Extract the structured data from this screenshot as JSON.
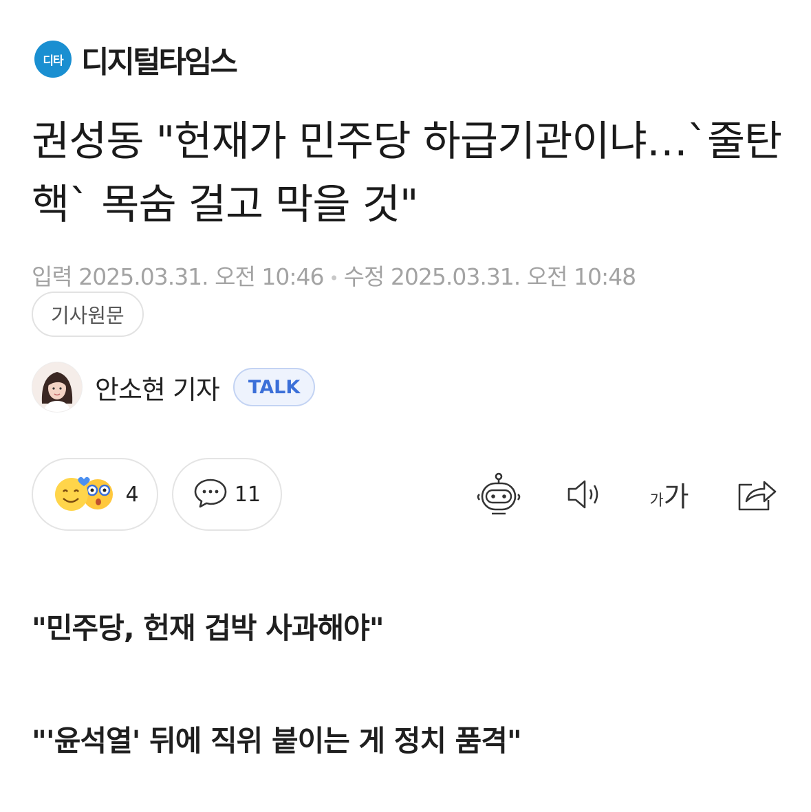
{
  "brand": {
    "badge": "디타",
    "name": "디지털타임스"
  },
  "headline": "권성동 \"헌재가 민주당 하급기관이냐…`줄탄핵` 목숨 걸고 막을 것\"",
  "meta": {
    "input_label": "입력",
    "input_time": "2025.03.31. 오전 10:46",
    "modified_label": "수정",
    "modified_time": "2025.03.31. 오전 10:48"
  },
  "original_article_label": "기사원문",
  "author": {
    "name": "안소현 기자",
    "talk_label": "TALK"
  },
  "reactions": {
    "count": "4"
  },
  "comments": {
    "count": "11"
  },
  "toolbar": {
    "font_small": "가",
    "font_large": "가"
  },
  "subheads": [
    "\"민주당, 헌재 겁박 사과해야\"",
    "\"'윤석열' 뒤에 직위 붙이는 게 정치 품격\""
  ],
  "colors": {
    "brand_blue": "#1a8fd1",
    "talk_blue": "#3b6fd8",
    "meta_gray": "#a3a3a3"
  },
  "icons": [
    "smile-emoji-icon",
    "surprised-emoji-icon",
    "comment-bubble-icon",
    "robot-summary-icon",
    "speaker-icon",
    "font-size-icon",
    "share-icon"
  ]
}
